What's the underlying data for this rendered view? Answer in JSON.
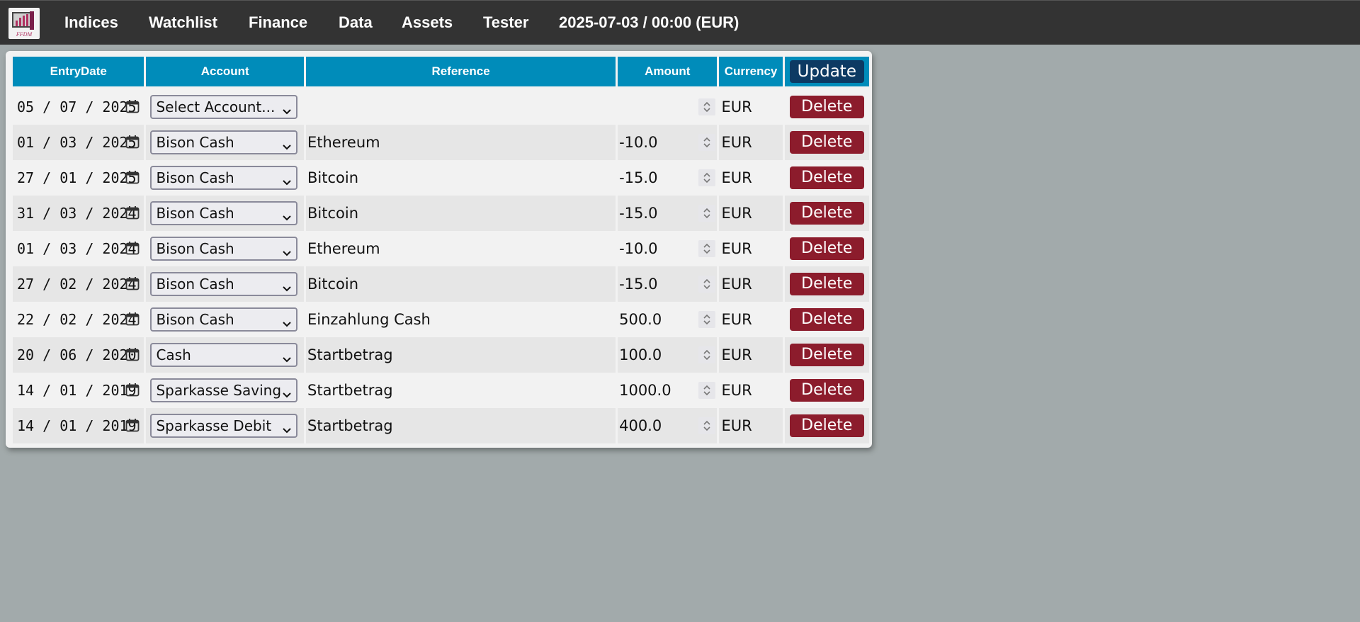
{
  "nav": {
    "items": [
      {
        "label": "Indices"
      },
      {
        "label": "Watchlist"
      },
      {
        "label": "Finance"
      },
      {
        "label": "Data"
      },
      {
        "label": "Assets"
      },
      {
        "label": "Tester"
      }
    ],
    "status": "2025-07-03 / 00:00 (EUR)",
    "logo_text": "FFDM"
  },
  "table": {
    "headers": {
      "entry_date": "EntryDate",
      "account": "Account",
      "reference": "Reference",
      "amount": "Amount",
      "currency": "Currency",
      "update": "Update"
    },
    "delete_label": "Delete",
    "rows": [
      {
        "date": "05 / 07 / 2025",
        "account": "Select Account...",
        "reference": "",
        "amount": "",
        "currency": "EUR"
      },
      {
        "date": "01 / 03 / 2025",
        "account": "Bison Cash",
        "reference": "Ethereum",
        "amount": "-10.0",
        "currency": "EUR"
      },
      {
        "date": "27 / 01 / 2025",
        "account": "Bison Cash",
        "reference": "Bitcoin",
        "amount": "-15.0",
        "currency": "EUR"
      },
      {
        "date": "31 / 03 / 2024",
        "account": "Bison Cash",
        "reference": "Bitcoin",
        "amount": "-15.0",
        "currency": "EUR"
      },
      {
        "date": "01 / 03 / 2024",
        "account": "Bison Cash",
        "reference": "Ethereum",
        "amount": "-10.0",
        "currency": "EUR"
      },
      {
        "date": "27 / 02 / 2024",
        "account": "Bison Cash",
        "reference": "Bitcoin",
        "amount": "-15.0",
        "currency": "EUR"
      },
      {
        "date": "22 / 02 / 2024",
        "account": "Bison Cash",
        "reference": "Einzahlung Cash",
        "amount": "500.0",
        "currency": "EUR"
      },
      {
        "date": "20 / 06 / 2020",
        "account": "Cash",
        "reference": "Startbetrag",
        "amount": "100.0",
        "currency": "EUR"
      },
      {
        "date": "14 / 01 / 2019",
        "account": "Sparkasse Saving",
        "reference": "Startbetrag",
        "amount": "1000.0",
        "currency": "EUR"
      },
      {
        "date": "14 / 01 / 2019",
        "account": "Sparkasse Debit",
        "reference": "Startbetrag",
        "amount": "400.0",
        "currency": "EUR"
      }
    ]
  },
  "colors": {
    "nav_bg": "#333333",
    "page_bg": "#a2aaab",
    "header_bg": "#008cba",
    "delete_bg": "#8c1c2c",
    "update_bg": "#0d3a63"
  },
  "icons": {
    "date": "calendar-icon",
    "select": "chevron-down-icon",
    "amount": "spinner-arrows-icon",
    "logo": "app-logo"
  }
}
